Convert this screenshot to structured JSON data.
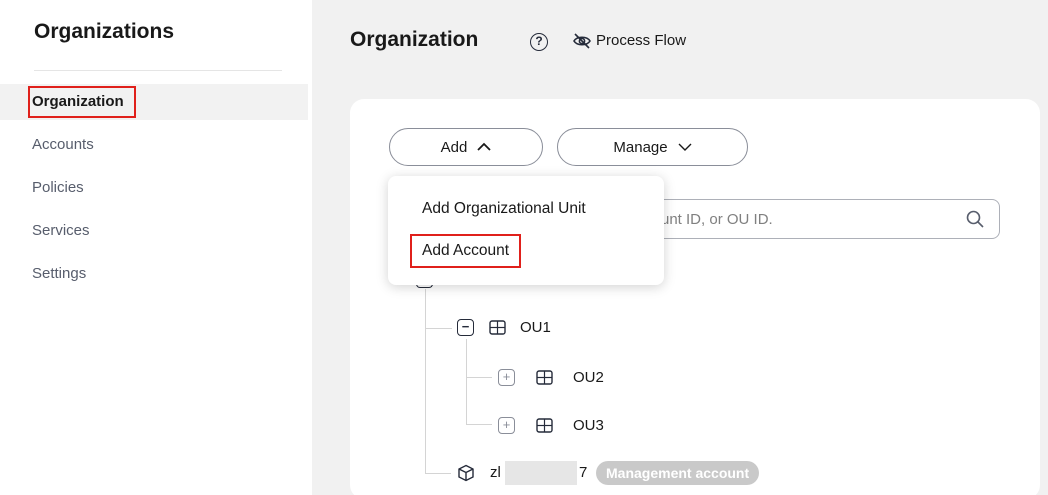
{
  "sidebar": {
    "title": "Organizations",
    "items": [
      {
        "label": "Organization"
      },
      {
        "label": "Accounts"
      },
      {
        "label": "Policies"
      },
      {
        "label": "Services"
      },
      {
        "label": "Settings"
      }
    ]
  },
  "header": {
    "title": "Organization",
    "help_icon": "question-circle-icon",
    "process_flow_label": "Process Flow",
    "process_flow_icon": "eye-off-icon"
  },
  "toolbar": {
    "add_label": "Add",
    "manage_label": "Manage"
  },
  "dropdown": {
    "items": [
      "Add Organizational Unit",
      "Add Account"
    ]
  },
  "search": {
    "visible_placeholder": "unt ID, or OU ID."
  },
  "tree": {
    "nodes": [
      {
        "label": "OU1"
      },
      {
        "label": "OU2"
      },
      {
        "label": "OU3"
      }
    ],
    "account": {
      "name_start": "zl",
      "name_end": "7",
      "badge": "Management account"
    }
  },
  "colors": {
    "highlight": "#e0201b",
    "main_bg": "#f1f1f1",
    "badge_bg": "#c9c9c9"
  }
}
